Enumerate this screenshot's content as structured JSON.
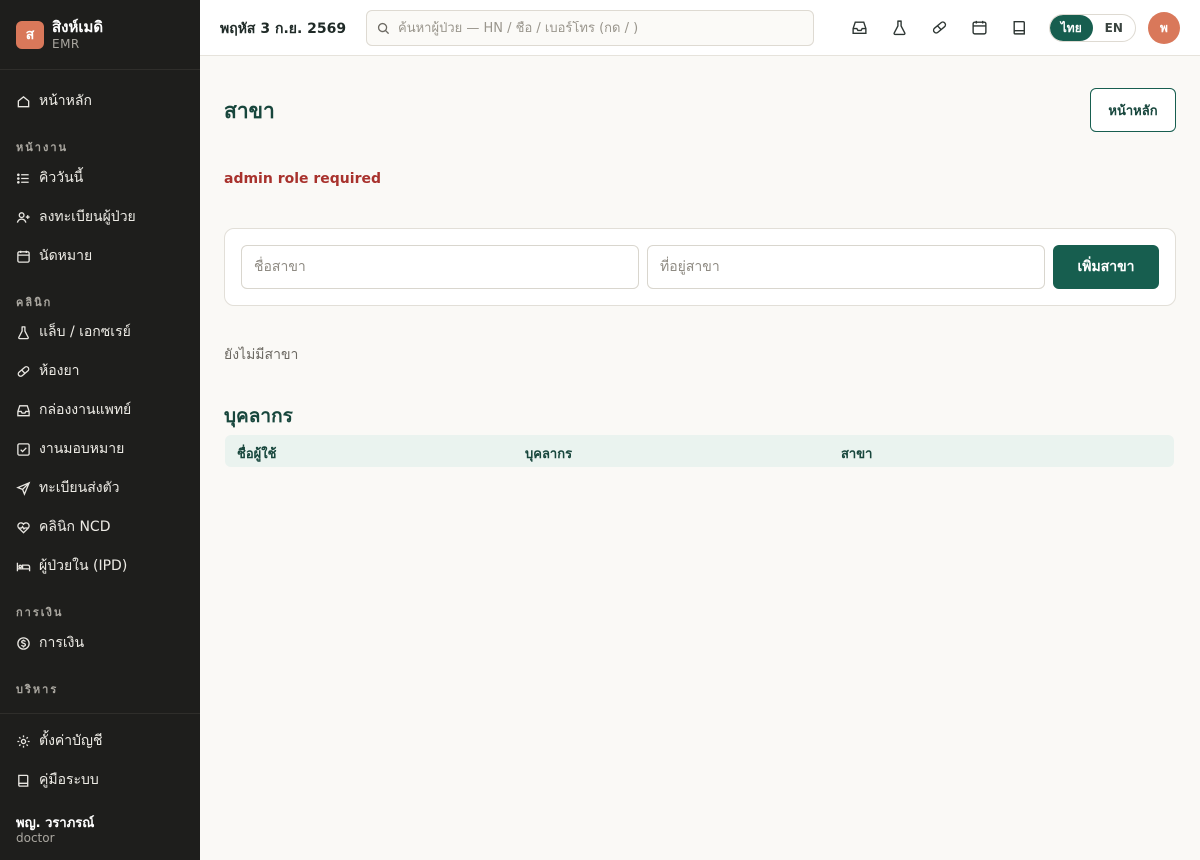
{
  "brand": {
    "logo_letter": "ส",
    "name": "สิงห์เมดิ",
    "sub": "EMR"
  },
  "sidebar": {
    "home": "หน้าหลัก",
    "sections": [
      "หน้างาน",
      "คลินิก",
      "การเงิน",
      "บริหาร"
    ],
    "work": [
      "คิววันนี้",
      "ลงทะเบียนผู้ป่วย",
      "นัดหมาย"
    ],
    "clinic": [
      "แล็บ / เอกซเรย์",
      "ห้องยา",
      "กล่องงานแพทย์",
      "งานมอบหมาย",
      "ทะเบียนส่งตัว",
      "คลินิก NCD",
      "ผู้ป่วยใน (IPD)"
    ],
    "finance": [
      "การเงิน"
    ],
    "settings": "ตั้งค่าบัญชี",
    "manual": "คู่มือระบบ",
    "user_name": "พญ. วราภรณ์",
    "user_role": "doctor"
  },
  "topbar": {
    "date": "พฤหัส 3 ก.ย. 2569",
    "search_placeholder": "ค้นหาผู้ป่วย — HN / ชื่อ / เบอร์โทร (กด / )",
    "lang_th": "ไทย",
    "lang_en": "EN",
    "active_lang": "th",
    "avatar_initial": "พ",
    "icons": [
      "inbox-icon",
      "flask-icon",
      "pill-icon",
      "calendar-icon",
      "book-icon"
    ]
  },
  "main": {
    "title": "สาขา",
    "home_button": "หน้าหลัก",
    "error": "admin role required",
    "form": {
      "name_placeholder": "ชื่อสาขา",
      "address_placeholder": "ที่อยู่สาขา",
      "add_button": "เพิ่มสาขา"
    },
    "empty": "ยังไม่มีสาขา",
    "staff_title": "บุคลากร",
    "columns": [
      "ชื่อผู้ใช้",
      "บุคลากร",
      "สาขา"
    ]
  },
  "colors": {
    "primary": "#175e4f",
    "sidebar": "#1e1e1c",
    "accent": "#d9785a",
    "error": "#a8322d"
  }
}
